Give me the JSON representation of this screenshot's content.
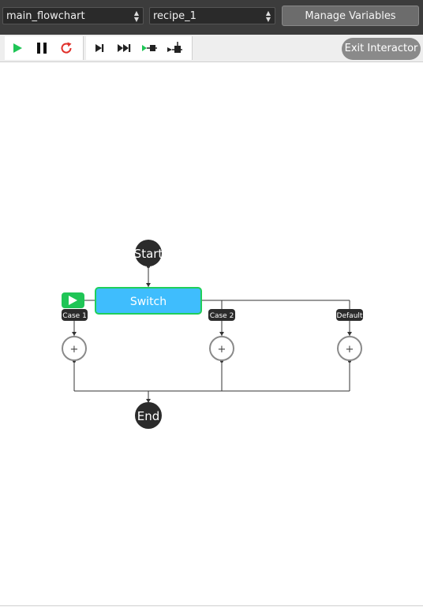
{
  "topbar": {
    "flowchart_select": "main_flowchart",
    "recipe_select": "recipe_1",
    "manage_variables": "Manage Variables"
  },
  "toolbar": {
    "exit_interactor": "Exit Interactor"
  },
  "diagram": {
    "start": "Start",
    "switch": "Switch",
    "case1": "Case 1",
    "case2": "Case 2",
    "default": "Default",
    "end": "End",
    "add": "+"
  },
  "colors": {
    "switch_fill": "#3fbdfd",
    "switch_border": "#1fcf5a",
    "play_badge": "#1fc556",
    "node_dark": "#2b2b2b"
  }
}
